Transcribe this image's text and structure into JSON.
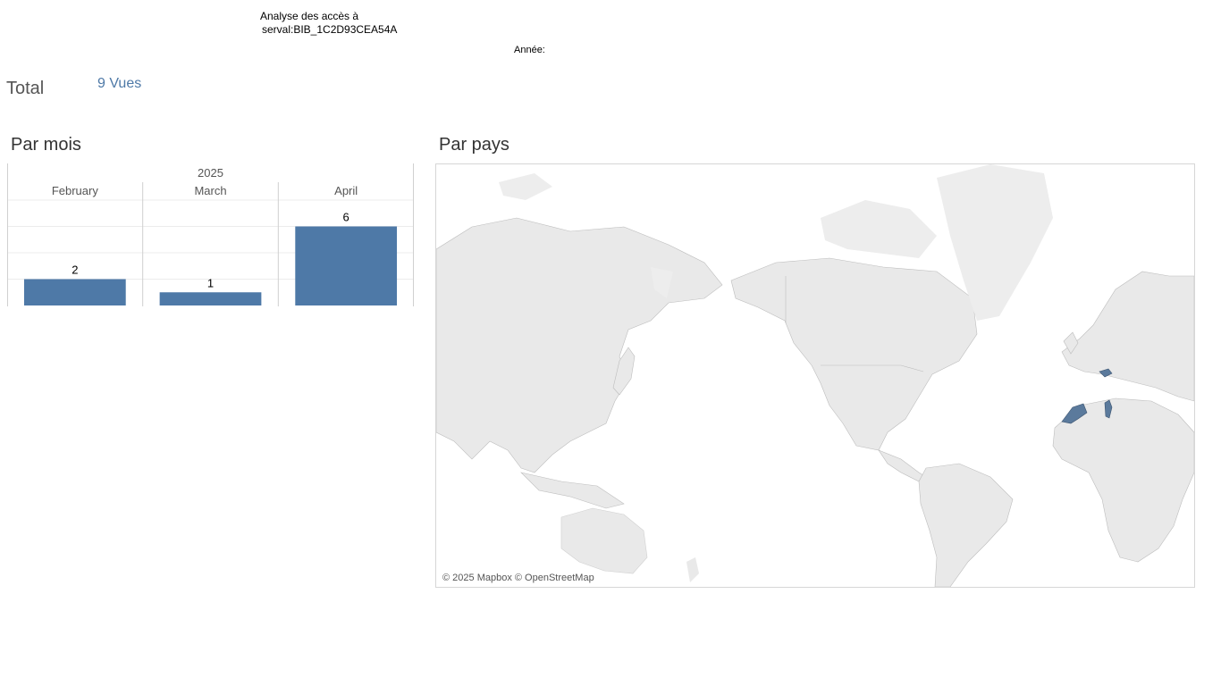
{
  "header": {
    "title_line1": "Analyse des accès à",
    "title_line2": "serval:BIB_1C2D93CEA54A",
    "year_label": "Année:"
  },
  "total": {
    "label": "Total",
    "value": "9 Vues"
  },
  "sections": {
    "par_mois": "Par mois",
    "par_pays": "Par pays"
  },
  "chart_data": {
    "type": "bar",
    "title": "",
    "group_label": "2025",
    "categories": [
      "February",
      "March",
      "April"
    ],
    "values": [
      2,
      1,
      6
    ],
    "ylim": [
      0,
      8
    ],
    "grid": true,
    "bar_color": "#4e79a7"
  },
  "map": {
    "credit": "© 2025 Mapbox © OpenStreetMap",
    "land_color": "#e9e9e9",
    "highlight_color": "#5b7a9c",
    "highlighted_regions": [
      "Morocco",
      "Tunisia",
      "Switzerland"
    ]
  }
}
